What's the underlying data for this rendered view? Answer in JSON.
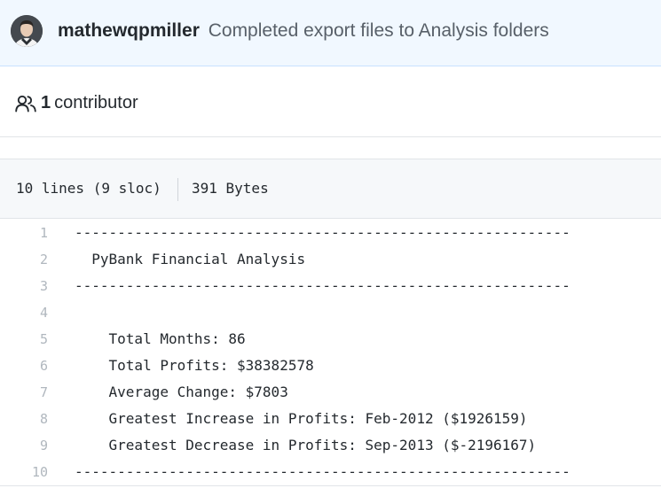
{
  "commit": {
    "author": "mathewqpmiller",
    "message": "Completed export files to Analysis folders"
  },
  "contributors": {
    "count": "1",
    "label": "contributor",
    "icon": "people-icon"
  },
  "file_info": {
    "lines": "10 lines (9 sloc)",
    "size": "391 Bytes"
  },
  "code": {
    "lines": [
      {
        "num": "1",
        "text": "----------------------------------------------------------"
      },
      {
        "num": "2",
        "text": "  PyBank Financial Analysis"
      },
      {
        "num": "3",
        "text": "----------------------------------------------------------"
      },
      {
        "num": "4",
        "text": ""
      },
      {
        "num": "5",
        "text": "    Total Months: 86"
      },
      {
        "num": "6",
        "text": "    Total Profits: $38382578"
      },
      {
        "num": "7",
        "text": "    Average Change: $7803"
      },
      {
        "num": "8",
        "text": "    Greatest Increase in Profits: Feb-2012 ($1926159)"
      },
      {
        "num": "9",
        "text": "    Greatest Decrease in Profits: Sep-2013 ($-2196167)"
      },
      {
        "num": "10",
        "text": "----------------------------------------------------------"
      }
    ]
  }
}
